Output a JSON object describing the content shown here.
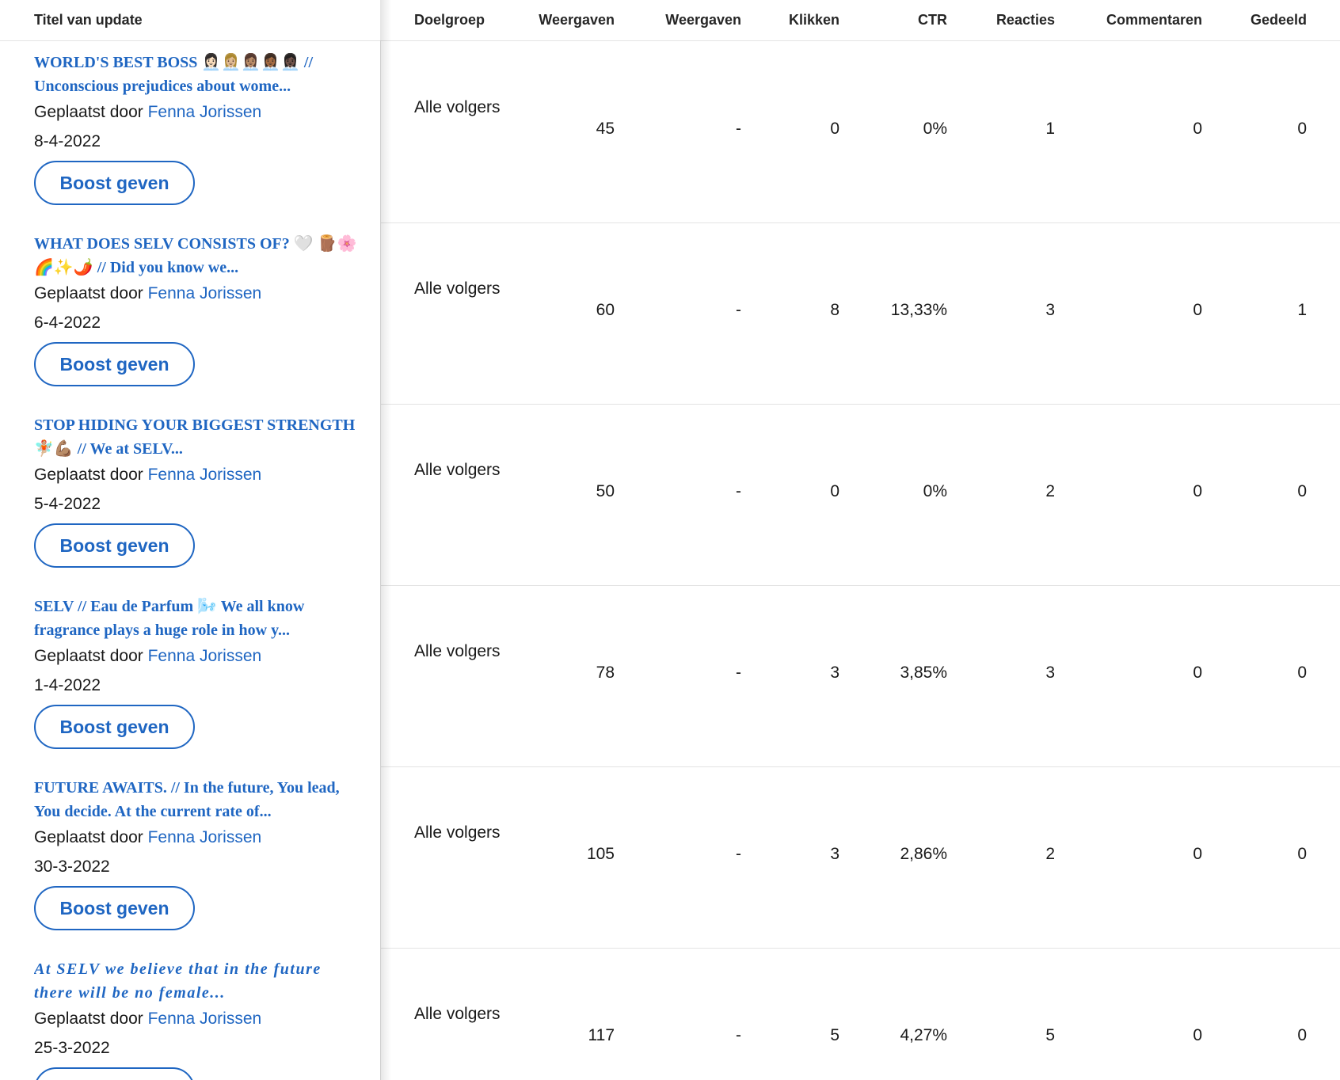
{
  "columns": {
    "title": "Titel van update",
    "audience": "Doelgroep",
    "impressions": "Weergaven",
    "views": "Weergaven",
    "clicks": "Klikken",
    "ctr": "CTR",
    "reactions": "Reacties",
    "comments": "Commentaren",
    "shares": "Gedeeld"
  },
  "posted_by_prefix": "Geplaatst door",
  "boost_label": "Boost geven",
  "rows": [
    {
      "title": "WORLD'S BEST BOSS 👩🏻‍💼👩🏼‍💼👩🏽‍💼👩🏾‍💼👩🏿‍💼 // Unconscious prejudices about wome...",
      "author": "Fenna Jorissen",
      "date": "8-4-2022",
      "audience": "Alle volgers",
      "impressions": "45",
      "views": "-",
      "clicks": "0",
      "ctr": "0%",
      "reactions": "1",
      "comments": "0",
      "shares": "0"
    },
    {
      "title": "WHAT DOES SELV CONSISTS OF? 🤍 🪵🌸🌈✨🌶️ // Did you know we...",
      "author": "Fenna Jorissen",
      "date": "6-4-2022",
      "audience": "Alle volgers",
      "impressions": "60",
      "views": "-",
      "clicks": "8",
      "ctr": "13,33%",
      "reactions": "3",
      "comments": "0",
      "shares": "1"
    },
    {
      "title": "STOP HIDING YOUR BIGGEST STRENGTH 🧚🏼💪🏽 // We at SELV...",
      "author": "Fenna Jorissen",
      "date": "5-4-2022",
      "audience": "Alle volgers",
      "impressions": "50",
      "views": "-",
      "clicks": "0",
      "ctr": "0%",
      "reactions": "2",
      "comments": "0",
      "shares": "0"
    },
    {
      "title": "SELV // Eau de Parfum 🌬️ We all know fragrance plays a huge role in how y...",
      "author": "Fenna Jorissen",
      "date": "1-4-2022",
      "audience": "Alle volgers",
      "impressions": "78",
      "views": "-",
      "clicks": "3",
      "ctr": "3,85%",
      "reactions": "3",
      "comments": "0",
      "shares": "0"
    },
    {
      "title": "FUTURE AWAITS. // In the future, You lead, You decide. At the current rate of...",
      "author": "Fenna Jorissen",
      "date": "30-3-2022",
      "audience": "Alle volgers",
      "impressions": "105",
      "views": "-",
      "clicks": "3",
      "ctr": "2,86%",
      "reactions": "2",
      "comments": "0",
      "shares": "0"
    },
    {
      "title": "At SELV we believe that in the future there will be no female...",
      "author": "Fenna Jorissen",
      "date": "25-3-2022",
      "audience": "Alle volgers",
      "impressions": "117",
      "views": "-",
      "clicks": "5",
      "ctr": "4,27%",
      "reactions": "5",
      "comments": "0",
      "shares": "0"
    }
  ],
  "colors": {
    "link": "#1f66c2",
    "text": "#191919",
    "divider": "#e3e3e3"
  }
}
